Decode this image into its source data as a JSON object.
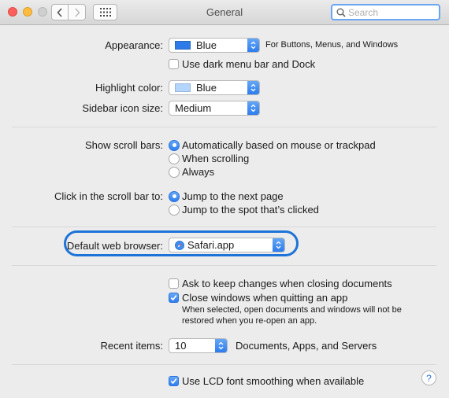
{
  "window": {
    "title": "General"
  },
  "search": {
    "placeholder": "Search"
  },
  "appearance": {
    "label": "Appearance:",
    "value": "Blue",
    "swatch_color": "#2e7ae6",
    "note": "For Buttons, Menus, and Windows",
    "dark_menu": {
      "label": "Use dark menu bar and Dock",
      "checked": false
    }
  },
  "highlight": {
    "label": "Highlight color:",
    "value": "Blue",
    "swatch_color": "#b4d5fc"
  },
  "sidebar_icon": {
    "label": "Sidebar icon size:",
    "value": "Medium"
  },
  "scroll_bars": {
    "label": "Show scroll bars:",
    "options": [
      {
        "label": "Automatically based on mouse or trackpad",
        "selected": true
      },
      {
        "label": "When scrolling",
        "selected": false
      },
      {
        "label": "Always",
        "selected": false
      }
    ]
  },
  "scroll_click": {
    "label": "Click in the scroll bar to:",
    "options": [
      {
        "label": "Jump to the next page",
        "selected": true
      },
      {
        "label": "Jump to the spot that’s clicked",
        "selected": false
      }
    ]
  },
  "browser": {
    "label": "Default web browser:",
    "value": "Safari.app"
  },
  "ask_keep": {
    "label": "Ask to keep changes when closing documents",
    "checked": false
  },
  "close_windows": {
    "label": "Close windows when quitting an app",
    "checked": true,
    "help_line1": "When selected, open documents and windows will not be",
    "help_line2": "restored when you re-open an app."
  },
  "recent": {
    "label": "Recent items:",
    "value": "10",
    "note": "Documents, Apps, and Servers"
  },
  "lcd": {
    "label": "Use LCD font smoothing when available",
    "checked": true
  },
  "help_button": {
    "glyph": "?"
  }
}
